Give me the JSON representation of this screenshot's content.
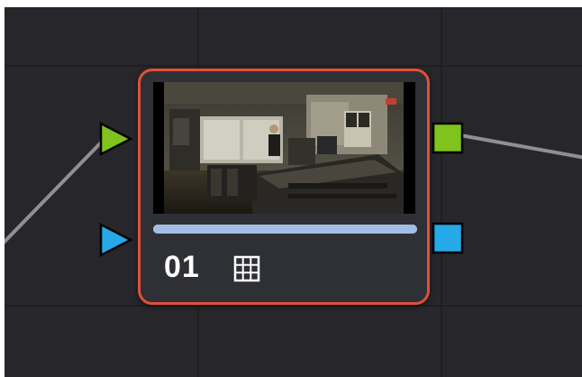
{
  "node": {
    "label": "01",
    "type_icon": "grid-icon",
    "border_color": "#e0503a",
    "thumbnail": "clip-thumbnail-workshop",
    "progress": 1.0,
    "progress_color": "#8aa6d6"
  },
  "ports": {
    "input_rgb": {
      "icon": "triangle-right-icon",
      "color": "#7fc31c"
    },
    "input_alpha": {
      "icon": "triangle-right-icon",
      "color": "#25a9e8"
    },
    "output_rgb": {
      "icon": "square-icon",
      "color": "#7fc31c"
    },
    "output_alpha": {
      "icon": "square-icon",
      "color": "#25a9e8"
    }
  },
  "canvas": {
    "background": "#27272b",
    "wire_color": "#8f8f95"
  }
}
